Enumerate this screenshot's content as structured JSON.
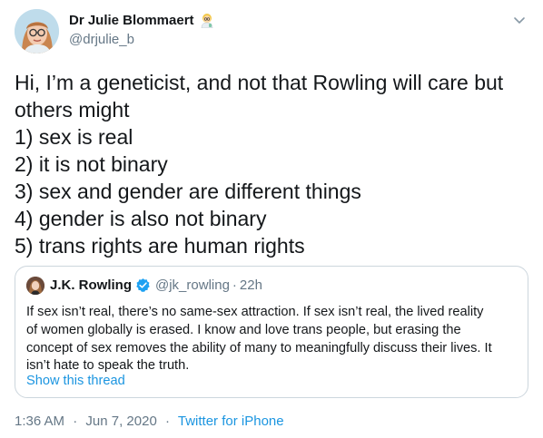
{
  "author": {
    "display_name": "Dr Julie Blommaert",
    "handle": "@drjulie_b",
    "name_emoji": "woman-scientist-emoji",
    "avatar": "profile-avatar"
  },
  "tweet": {
    "lines": [
      "Hi, I’m a geneticist, and not that Rowling will care but",
      "others might",
      "1) sex is real",
      "2) it is not binary",
      "3) sex and gender are different things",
      "4) gender is also not binary",
      "5) trans rights are human rights"
    ]
  },
  "quoted": {
    "display_name": "J.K. Rowling",
    "handle": "@jk_rowling",
    "separator": "·",
    "time": "22h",
    "verified_icon": "verified-badge-icon",
    "lines": [
      "If sex isn’t real, there’s no same-sex attraction. If sex isn’t real, the lived reality",
      "of women globally is erased. I know and love trans people, but erasing the",
      "concept of sex removes the ability of many to meaningfully discuss their lives. It",
      "isn’t hate to speak the truth."
    ],
    "thread_link": "Show this thread"
  },
  "meta": {
    "time": "1:36 AM",
    "separator": "·",
    "date": "Jun 7, 2020",
    "source": "Twitter for iPhone"
  },
  "colors": {
    "text": "#14171a",
    "secondary": "#657786",
    "link": "#1b95e0",
    "border": "#ccd6dd",
    "verified": "#1da1f2"
  }
}
